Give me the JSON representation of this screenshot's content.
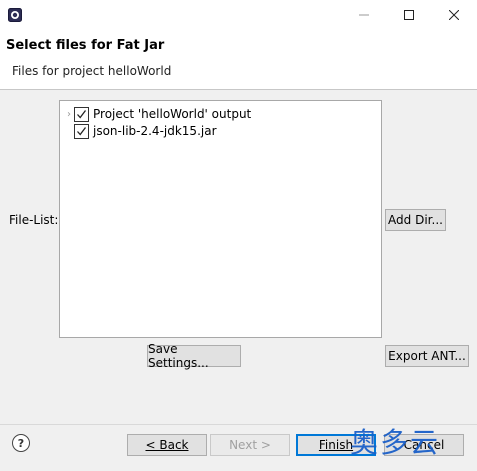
{
  "window": {
    "title_controls": {
      "minimize": "—",
      "maximize": "☐",
      "close": "✕"
    }
  },
  "header": {
    "title": "Select files for Fat Jar",
    "subtitle": "Files for project helloWorld"
  },
  "file_list": {
    "label": "File-List:",
    "items": [
      {
        "label": "Project 'helloWorld' output",
        "checked": true,
        "expandable": true
      },
      {
        "label": "json-lib-2.4-jdk15.jar",
        "checked": true,
        "expandable": false
      }
    ]
  },
  "buttons": {
    "add_dir": "Add Dir...",
    "save_settings": "Save Settings...",
    "export_ant": "Export ANT...",
    "back": "< Back",
    "next": "Next >",
    "finish": "Finish",
    "cancel": "Cancel"
  },
  "help": {
    "glyph": "?"
  },
  "watermark": {
    "text": "奥多云"
  },
  "colors": {
    "accent": "#0078d7",
    "watermark": "#1a5fc8"
  }
}
